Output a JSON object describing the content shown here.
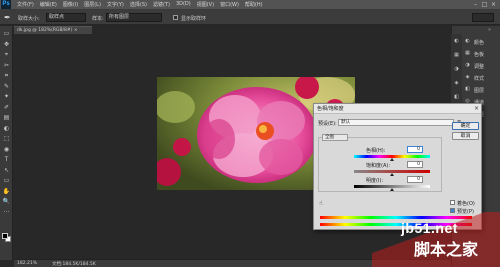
{
  "app": {
    "logo": "Ps",
    "menu": [
      "文件(F)",
      "编辑(E)",
      "图像(I)",
      "图层(L)",
      "文字(Y)",
      "选择(S)",
      "滤镜(T)",
      "3D(D)",
      "视图(V)",
      "窗口(W)",
      "帮助(H)"
    ],
    "window_controls": [
      "–",
      "□",
      "×"
    ]
  },
  "options_bar": {
    "tool_icon": "eyedropper-icon",
    "sample_size_label": "取样大小:",
    "sample_size_value": "取样点",
    "sample_label": "样本:",
    "sample_value": "所有图层",
    "show_ring_label": "显示取样环"
  },
  "document": {
    "tab_title": "dk.jpg @ 182%(RGB/8#) ×",
    "zoom": "182.21%",
    "doc_info": "文档:184.5K/184.5K"
  },
  "tools": [
    "▭",
    "✥",
    "⌖",
    "✂",
    "⌗",
    "✎",
    "✦",
    "✐",
    "▤",
    "◐",
    "⬚",
    "◉",
    "T",
    "↖",
    "▭",
    "✋",
    "🔍",
    "···"
  ],
  "right_panel": {
    "items": [
      {
        "icon": "color-icon",
        "glyph": "◐",
        "label": "颜色"
      },
      {
        "icon": "swatches-icon",
        "glyph": "▦",
        "label": "色板"
      },
      {
        "icon": "adjustments-icon",
        "glyph": "◑",
        "label": "调整"
      },
      {
        "icon": "styles-icon",
        "glyph": "◈",
        "label": "样式"
      },
      {
        "icon": "layers-icon",
        "glyph": "◧",
        "label": "图层"
      },
      {
        "icon": "channels-icon",
        "glyph": "◎",
        "label": "通道"
      },
      {
        "icon": "paths-icon",
        "glyph": "◇",
        "label": "路径"
      }
    ],
    "collapse": "»"
  },
  "dialog": {
    "title": "色相/饱和度",
    "close": "×",
    "preset_label": "预设(E):",
    "preset_value": "默认",
    "preset_menu_icon": "≡",
    "channel_value": "全图",
    "hue_label": "色相(H):",
    "hue_value": "0",
    "saturation_label": "饱和度(A):",
    "saturation_value": "0",
    "lightness_label": "明度(I):",
    "lightness_value": "0",
    "ok_label": "确定",
    "cancel_label": "取消",
    "colorize_label": "着色(O)",
    "preview_label": "预览(P)",
    "hue_pos": 0.5,
    "sat_pos": 0.5,
    "light_pos": 0.5
  },
  "watermark": {
    "line1": "jb51.net",
    "line2": "脚本之家"
  },
  "colors": {
    "workspace": "#282828",
    "panel": "#3a3a3a",
    "dialog": "#d9d9d9",
    "accent": "#3a86d6",
    "watermark_red": "#be1e1e"
  }
}
